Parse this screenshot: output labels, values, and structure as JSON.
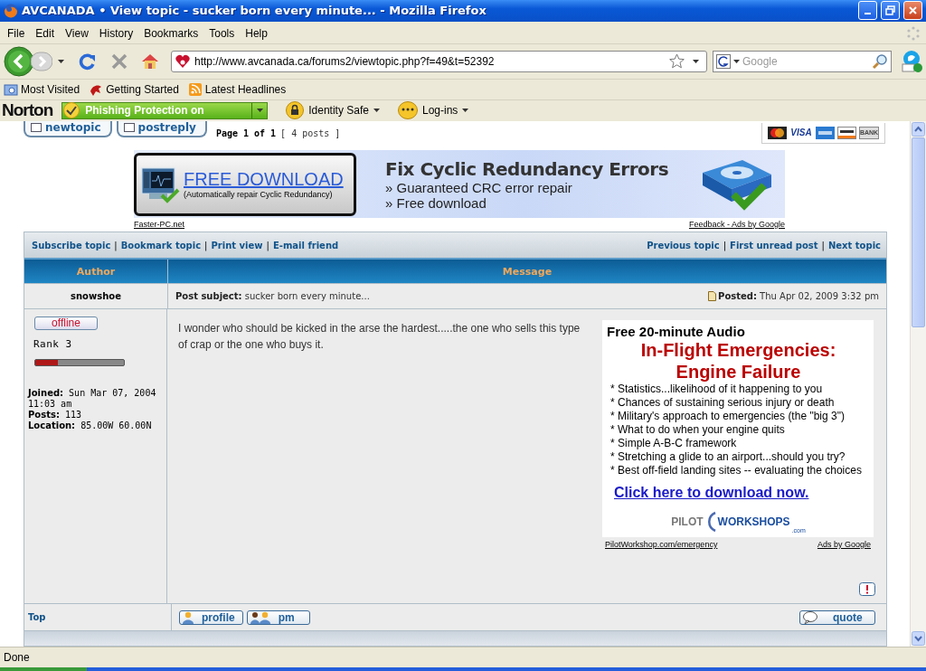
{
  "window": {
    "title": "AVCANADA • View topic - sucker born every minute... - Mozilla Firefox"
  },
  "menu": [
    "File",
    "Edit",
    "View",
    "History",
    "Bookmarks",
    "Tools",
    "Help"
  ],
  "address": {
    "url": "http://www.avcanada.ca/forums2/viewtopic.php?f=49&t=52392"
  },
  "search": {
    "placeholder": "Google"
  },
  "bookmarks": [
    {
      "kind": "folder",
      "label": "Most Visited"
    },
    {
      "kind": "page",
      "label": "Getting Started"
    },
    {
      "kind": "feed",
      "label": "Latest Headlines"
    }
  ],
  "norton": {
    "brand": "Norton",
    "phishing": "Phishing Protection on",
    "identity": "Identity Safe",
    "logins": "Log-ins"
  },
  "page": {
    "buttons": [
      "newtopic",
      "postreply"
    ],
    "pagination": "Page 1 of 1",
    "post_count": "[ 4 posts ]",
    "cards": [
      {
        "kind": "mastercard"
      },
      {
        "kind": "visa",
        "label": "VISA"
      },
      {
        "kind": "amex"
      },
      {
        "kind": "discover"
      },
      {
        "kind": "bank",
        "label": "BANK"
      }
    ],
    "banner": {
      "button": "FREE DOWNLOAD",
      "button_note": "(Automatically repair Cyclic Redundancy)",
      "headline": "Fix Cyclic Redundancy Errors",
      "bullets": [
        "» Guaranteed CRC error repair",
        "» Free download"
      ],
      "source": "Faster-PC.net",
      "feedback": "Feedback - Ads by Google"
    },
    "separator": "|",
    "topic_links": [
      "Subscribe topic",
      "Bookmark topic",
      "Print view",
      "E-mail friend"
    ],
    "nav_links": [
      "Previous topic",
      "First unread post",
      "Next topic"
    ],
    "columns": [
      "Author",
      "Message"
    ],
    "post": {
      "author": "snowshoe",
      "subject_label": "Post subject:",
      "subject": "sucker born every minute...",
      "posted_label": "Posted:",
      "posted": "Thu Apr 02, 2009 3:32 pm",
      "status": "offline",
      "rank": "Rank 3",
      "rank_bar": {
        "level": 0.25
      },
      "details": [
        {
          "label": "Joined:",
          "value": "Sun Mar 07, 2004 11:03 am"
        },
        {
          "label": "Posts:",
          "value": "113"
        },
        {
          "label": "Location:",
          "value": "85.00W 60.00N"
        }
      ],
      "body": "I wonder who should be kicked in the arse the hardest.....the one who sells this type of crap or the one who buys it.",
      "ad": {
        "kicker": "Free 20-minute Audio",
        "title_lines": [
          "In-Flight Emergencies:",
          "Engine Failure"
        ],
        "bullets": [
          "* Statistics...likelihood of it happening to you",
          "* Chances of sustaining serious injury or death",
          "* Military's approach to emergencies (the \"big 3\")",
          "* What to do when your engine quits",
          "* Simple A-B-C framework",
          "* Stretching a glide to an airport...should you try?",
          "* Best off-field landing sites -- evaluating the choices"
        ],
        "link": "Click here to download now.",
        "logo_left": "PILOT",
        "logo_right": "WORKSHOPS",
        "logo_suffix": ".com",
        "url": "PilotWorkshop.com/emergency",
        "ads_by": "Ads by Google"
      },
      "top": "Top",
      "actions": [
        "profile",
        "pm"
      ],
      "quote": "quote"
    }
  },
  "status_bar": {
    "text": "Done"
  }
}
